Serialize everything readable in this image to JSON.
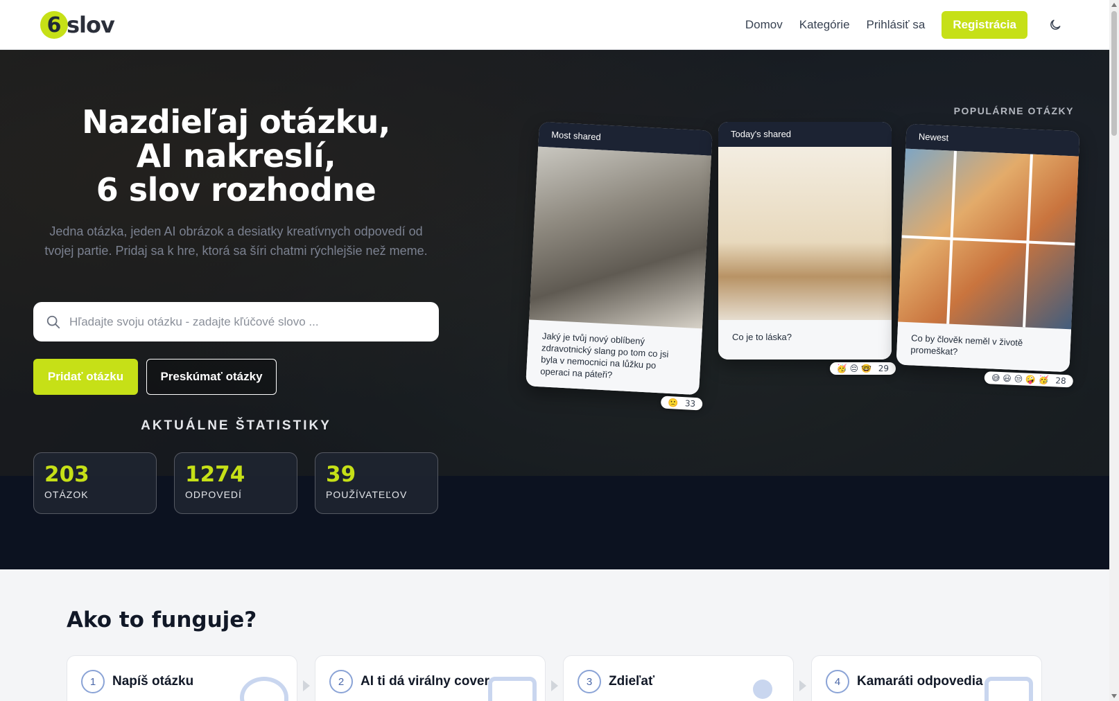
{
  "header": {
    "logo_digit": "6",
    "logo_text": "slov",
    "nav": [
      "Domov",
      "Kategórie",
      "Prihlásiť sa"
    ],
    "register_label": "Registrácia",
    "theme_icon": "moon-icon",
    "accent_color": "#c6e017"
  },
  "hero": {
    "title_line1": "Nazdieľaj otázku,",
    "title_line2": "AI nakreslí,",
    "title_line3": "6 slov rozhodne",
    "subtitle": "Jedna otázka, jeden AI obrázok a desiatky kreatívnych odpovedí od tvojej partie. Pridaj sa k hre, ktorá sa šíri chatmi rýchlejšie než meme.",
    "search_placeholder": "Hľadajte svoju otázku - zadajte kľúčové slovo ...",
    "search_icon": "search-icon",
    "add_button": "Pridať otázku",
    "explore_button": "Preskúmať otázky",
    "stats_title": "AKTUÁLNE ŠTATISTIKY",
    "popular_label": "POPULÁRNE OTÁZKY"
  },
  "stats": [
    {
      "value": "203",
      "label": "OTÁZOK"
    },
    {
      "value": "1274",
      "label": "ODPOVEDÍ"
    },
    {
      "value": "39",
      "label": "POUŽÍVATEĽOV"
    }
  ],
  "cards": [
    {
      "tag": "Most shared",
      "text": "Jaký je tvůj nový oblíbený zdravotnický slang po tom co jsi byla v nemocnici na lůžku po operaci na páteři?",
      "reactions": "🙁",
      "count": "33"
    },
    {
      "tag": "Today's shared",
      "text": "Co je to láska?",
      "reactions": "🥳 😔 🤓",
      "count": "29"
    },
    {
      "tag": "Newest",
      "text": "Co by člověk neměl v životě promeškat?",
      "reactions": "😅 😃 😒 🤪 🥳",
      "count": "28"
    }
  ],
  "how": {
    "title": "Ako to funguje?",
    "steps": [
      {
        "num": "1",
        "label": "Napíš otázku"
      },
      {
        "num": "2",
        "label": "AI ti dá virálny cover"
      },
      {
        "num": "3",
        "label": "Zdieľať"
      },
      {
        "num": "4",
        "label": "Kamaráti odpovedia"
      }
    ]
  }
}
